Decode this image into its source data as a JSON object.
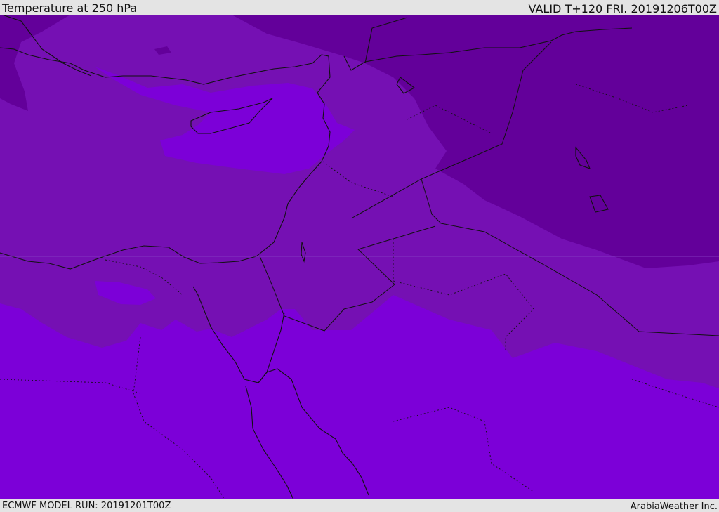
{
  "header": {
    "title": "Temperature at 250 hPa",
    "valid": "VALID T+120 FRI. 20191206T00Z"
  },
  "footer": {
    "model_run": "ECMWF MODEL RUN: 20191201T00Z",
    "credit": "ArabiaWeather Inc."
  },
  "colors": {
    "band_dark": "#63009a",
    "band_mid": "#7510b3",
    "band_light": "#7c00d8",
    "coastline": "#111111",
    "header_bg": "#e4e4e4"
  }
}
